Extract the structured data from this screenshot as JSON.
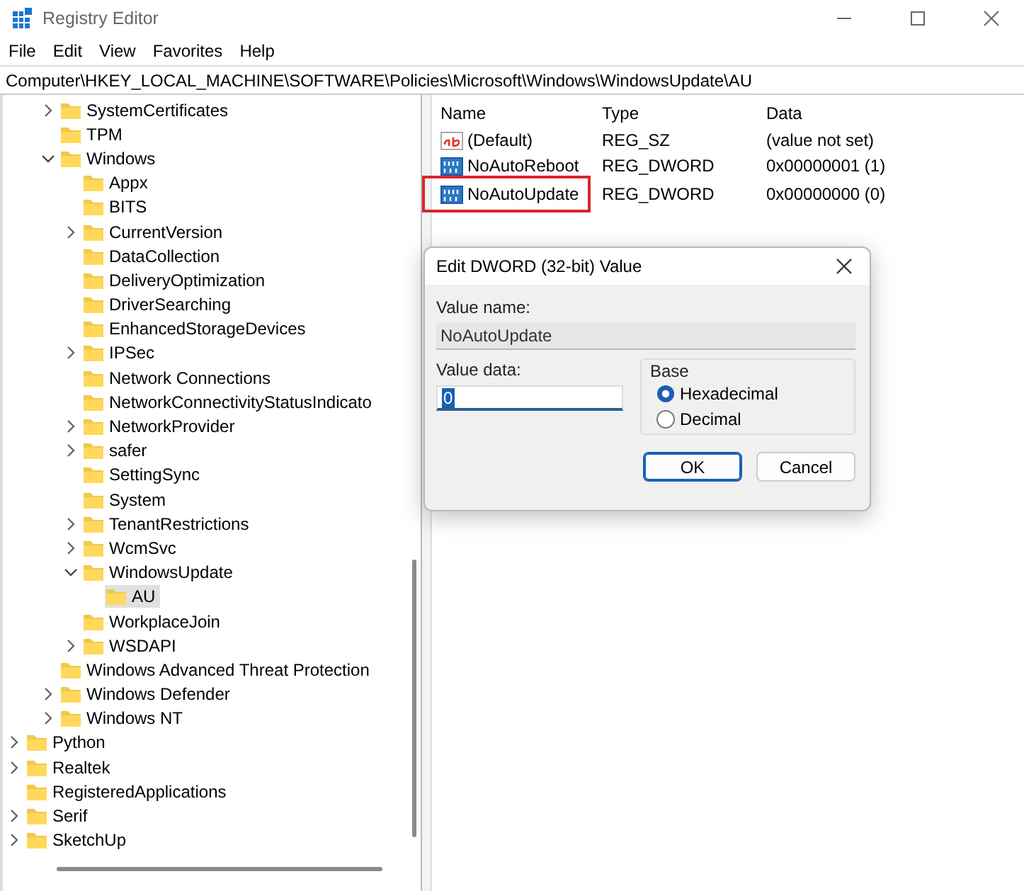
{
  "window": {
    "title": "Registry Editor"
  },
  "menu": [
    "File",
    "Edit",
    "View",
    "Favorites",
    "Help"
  ],
  "address": "Computer\\HKEY_LOCAL_MACHINE\\SOFTWARE\\Policies\\Microsoft\\Windows\\WindowsUpdate\\AU",
  "tree": [
    {
      "children": [
        {
          "children": [
            {
              "label": "SystemCertificates",
              "expandable": true,
              "expanded": false,
              "selected": false
            },
            {
              "label": "TPM",
              "expandable": false,
              "selected": false
            },
            {
              "label": "Windows",
              "expandable": true,
              "expanded": true,
              "selected": false,
              "children": [
                {
                  "label": "Appx",
                  "expandable": false,
                  "selected": false
                },
                {
                  "label": "BITS",
                  "expandable": false,
                  "selected": false
                },
                {
                  "label": "CurrentVersion",
                  "expandable": true,
                  "expanded": false,
                  "selected": false
                },
                {
                  "label": "DataCollection",
                  "expandable": false,
                  "selected": false
                },
                {
                  "label": "DeliveryOptimization",
                  "expandable": false,
                  "selected": false
                },
                {
                  "label": "DriverSearching",
                  "expandable": false,
                  "selected": false
                },
                {
                  "label": "EnhancedStorageDevices",
                  "expandable": false,
                  "selected": false
                },
                {
                  "label": "IPSec",
                  "expandable": true,
                  "expanded": false,
                  "selected": false
                },
                {
                  "label": "Network Connections",
                  "expandable": false,
                  "selected": false
                },
                {
                  "label": "NetworkConnectivityStatusIndicato",
                  "expandable": false,
                  "selected": false
                },
                {
                  "label": "NetworkProvider",
                  "expandable": true,
                  "expanded": false,
                  "selected": false
                },
                {
                  "label": "safer",
                  "expandable": true,
                  "expanded": false,
                  "selected": false
                },
                {
                  "label": "SettingSync",
                  "expandable": false,
                  "selected": false
                },
                {
                  "label": "System",
                  "expandable": false,
                  "selected": false
                },
                {
                  "label": "TenantRestrictions",
                  "expandable": true,
                  "expanded": false,
                  "selected": false
                },
                {
                  "label": "WcmSvc",
                  "expandable": true,
                  "expanded": false,
                  "selected": false
                },
                {
                  "label": "WindowsUpdate",
                  "expandable": true,
                  "expanded": true,
                  "selected": false,
                  "children": [
                    {
                      "label": "AU",
                      "expandable": false,
                      "selected": true
                    }
                  ]
                },
                {
                  "label": "WorkplaceJoin",
                  "expandable": false,
                  "selected": false
                },
                {
                  "label": "WSDAPI",
                  "expandable": true,
                  "expanded": false,
                  "selected": false
                }
              ]
            },
            {
              "label": "Windows Advanced Threat Protection",
              "expandable": false,
              "selected": false
            },
            {
              "label": "Windows Defender",
              "expandable": true,
              "expanded": false,
              "selected": false
            },
            {
              "label": "Windows NT",
              "expandable": true,
              "expanded": false,
              "selected": false
            }
          ]
        }
      ]
    },
    {
      "label": "Python",
      "expandable": true,
      "expanded": false,
      "selected": false
    },
    {
      "label": "Realtek",
      "expandable": true,
      "expanded": false,
      "selected": false
    },
    {
      "label": "RegisteredApplications",
      "expandable": false,
      "selected": false
    },
    {
      "label": "Serif",
      "expandable": true,
      "expanded": false,
      "selected": false
    },
    {
      "label": "SketchUp",
      "expandable": true,
      "expanded": false,
      "selected": false
    }
  ],
  "values": {
    "columns": [
      "Name",
      "Type",
      "Data"
    ],
    "rows": [
      {
        "kind": "string",
        "name": "(Default)",
        "type": "REG_SZ",
        "data": "(value not set)",
        "highlighted": false
      },
      {
        "kind": "binary",
        "name": "NoAutoReboot",
        "type": "REG_DWORD",
        "data": "0x00000001 (1)",
        "highlighted": false
      },
      {
        "kind": "binary",
        "name": "NoAutoUpdate",
        "type": "REG_DWORD",
        "data": "0x00000000 (0)",
        "highlighted": true
      }
    ]
  },
  "dialog": {
    "title": "Edit DWORD (32-bit) Value",
    "value_name_label": "Value name:",
    "value_name": "NoAutoUpdate",
    "value_data_label": "Value data:",
    "value_data": "0",
    "base_label": "Base",
    "base_options": [
      {
        "label": "Hexadecimal",
        "selected": true
      },
      {
        "label": "Decimal",
        "selected": false
      }
    ],
    "buttons": [
      {
        "label": "OK",
        "default": true
      },
      {
        "label": "Cancel",
        "default": false
      }
    ]
  }
}
